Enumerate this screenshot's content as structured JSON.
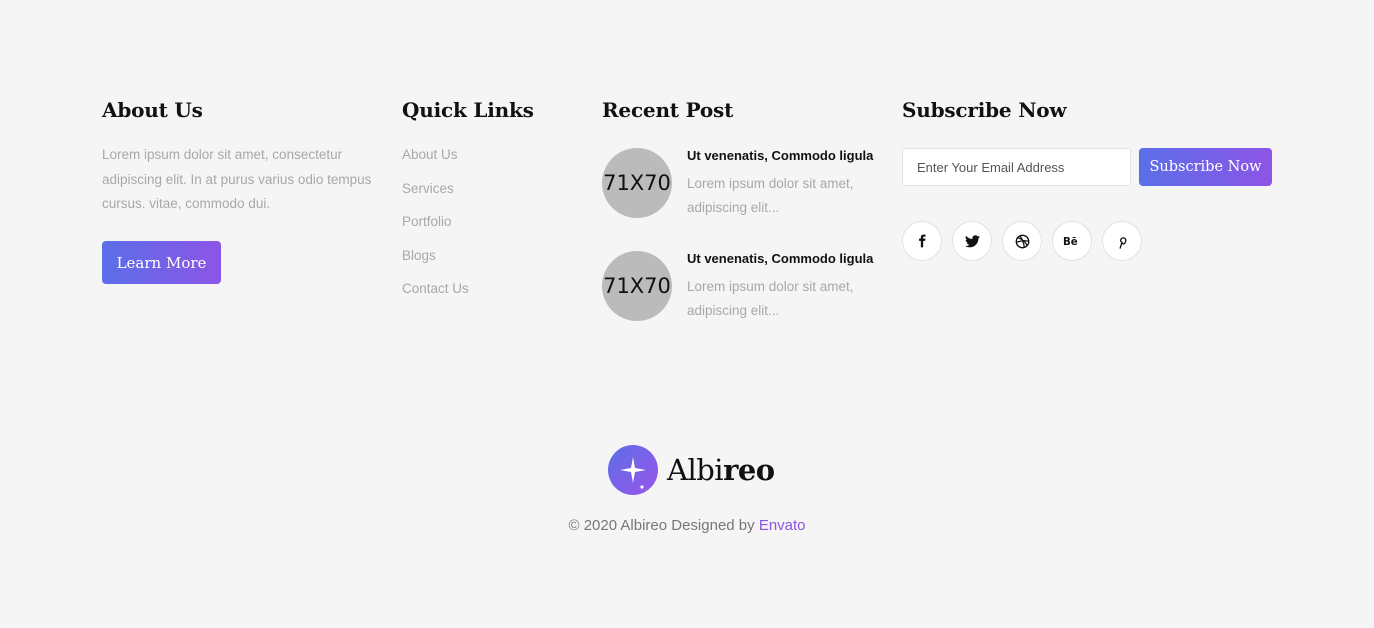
{
  "about": {
    "heading": "About Us",
    "text": "Lorem ipsum dolor sit amet, consectetur adipiscing elit. In at purus varius odio tempus cursus. vitae, commodo dui.",
    "button_label": "Learn More"
  },
  "quick_links": {
    "heading": "Quick Links",
    "items": [
      "About Us",
      "Services",
      "Portfolio",
      "Blogs",
      "Contact Us"
    ]
  },
  "recent_post": {
    "heading": "Recent Post",
    "posts": [
      {
        "thumb": "71X70",
        "title": "Ut venenatis, Commodo ligula",
        "excerpt": "Lorem ipsum dolor sit amet, adipiscing elit..."
      },
      {
        "thumb": "71X70",
        "title": "Ut venenatis, Commodo ligula",
        "excerpt": "Lorem ipsum dolor sit amet, adipiscing elit..."
      }
    ]
  },
  "subscribe": {
    "heading": "Subscribe Now",
    "email_placeholder": "Enter Your Email Address",
    "button_label": "Subscribe Now",
    "socials": [
      "facebook-icon",
      "twitter-icon",
      "dribbble-icon",
      "behance-icon",
      "pinterest-icon"
    ]
  },
  "brand": {
    "name_light": "Albi",
    "name_bold": "reo"
  },
  "footer": {
    "copyright": "© 2020 Albireo Designed by",
    "credit_link": "Envato"
  },
  "colors": {
    "accent_start": "#5b6ee8",
    "accent_end": "#8c55e6",
    "background": "#f5f5f5"
  }
}
